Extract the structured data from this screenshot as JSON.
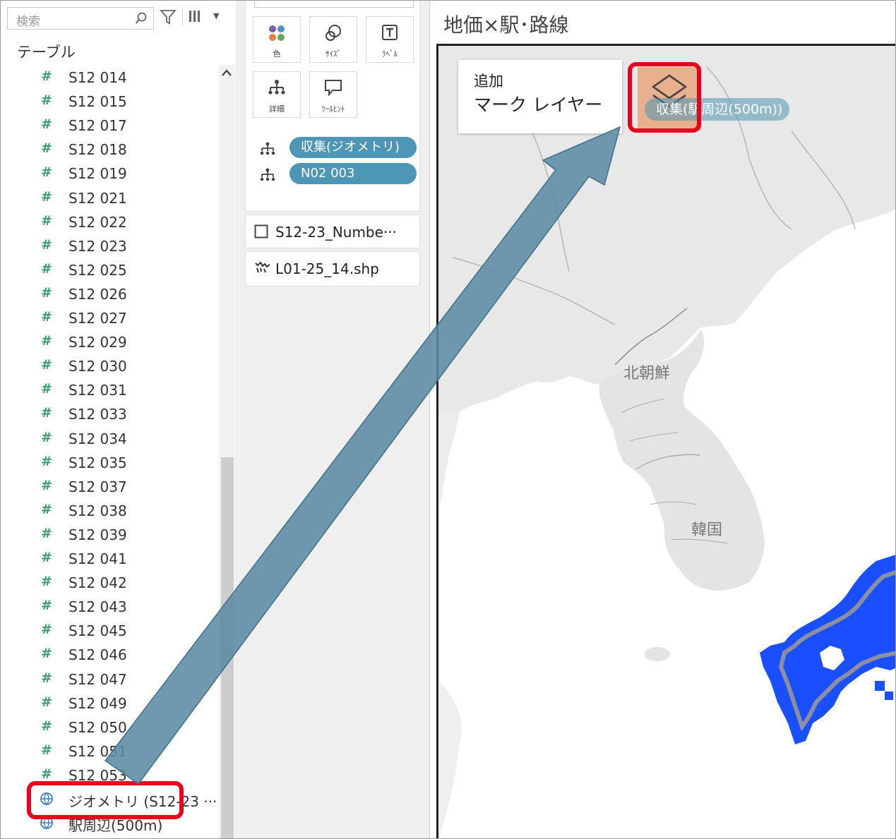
{
  "data_pane": {
    "search_placeholder": "検索",
    "tables_heading": "テーブル",
    "fields": [
      "S12 014",
      "S12 015",
      "S12 017",
      "S12 018",
      "S12 019",
      "S12 021",
      "S12 022",
      "S12 023",
      "S12 025",
      "S12 026",
      "S12 027",
      "S12 029",
      "S12 030",
      "S12 031",
      "S12 033",
      "S12 034",
      "S12 035",
      "S12 037",
      "S12 038",
      "S12 039",
      "S12 041",
      "S12 042",
      "S12 043",
      "S12 045",
      "S12 046",
      "S12 047",
      "S12 049",
      "S12 050",
      "S12 051",
      "S12 053"
    ],
    "geometry_field": "ジオメトリ (S12-23 ···",
    "station_field": "駅周辺(500m)"
  },
  "marks_card": {
    "buttons": [
      {
        "label": "色",
        "icon": "color-icon"
      },
      {
        "label": "ｻｲｽﾞ",
        "icon": "size-icon"
      },
      {
        "label": "ﾗﾍﾞﾙ",
        "icon": "label-icon"
      },
      {
        "label": "詳細",
        "icon": "detail-icon"
      },
      {
        "label": "ﾂｰﾙﾋﾝﾄ",
        "icon": "tooltip-icon"
      }
    ],
    "pills": [
      "収集(ジオメトリ)",
      "N02 003"
    ],
    "layers": [
      {
        "name": "S12-23_Numbe···",
        "icon": "checkbox-icon"
      },
      {
        "name": "L01-25_14.shp",
        "icon": "map-layer-icon"
      }
    ]
  },
  "view": {
    "sheet_title": "地価×駅･路線",
    "add_layer_line1": "追加",
    "add_layer_line2": "マーク レイヤー",
    "drop_pill": "収集(駅周辺(500m))",
    "map_labels": [
      "北朝鮮",
      "韓国"
    ]
  },
  "colors": {
    "pill_blue": "#4d96b5",
    "highlight_red": "#e8001c",
    "arrow_fill": "#5b8ba3",
    "station_blue": "#1a4fff",
    "drop_orange": "#e9b08d"
  }
}
